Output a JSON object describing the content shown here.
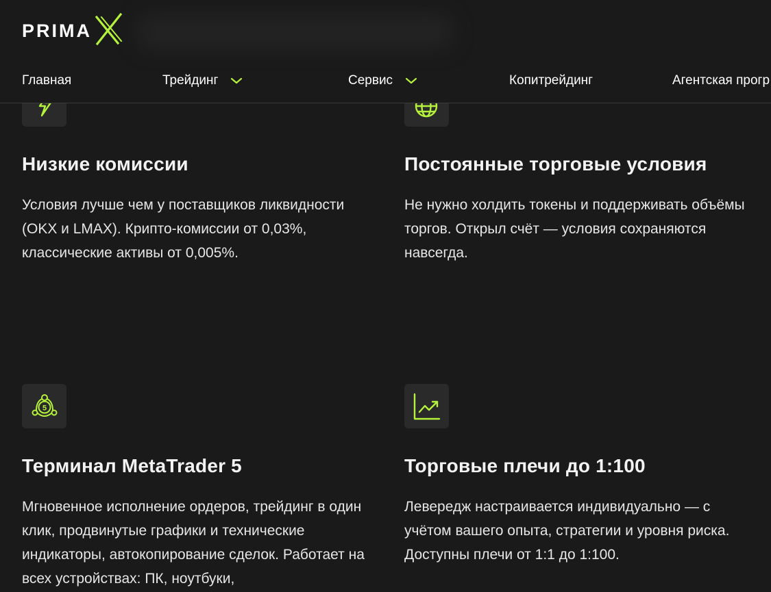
{
  "brand": {
    "name": "PRIMA",
    "mark": "X",
    "accent": "#b5f23c"
  },
  "nav": {
    "items": [
      {
        "label": "Главная",
        "has_dropdown": false
      },
      {
        "label": "Трейдинг",
        "has_dropdown": true
      },
      {
        "label": "Сервис",
        "has_dropdown": true
      },
      {
        "label": "Копитрейдинг",
        "has_dropdown": false
      },
      {
        "label": "Агентская прогр",
        "has_dropdown": false
      }
    ]
  },
  "features": [
    {
      "icon": "lightning-icon",
      "title": "Низкие комиссии",
      "text": "Условия лучше чем у поставщиков ликвидности (OKX и LMAX). Крипто-комиссии от 0,03%, классические активы от 0,005%."
    },
    {
      "icon": "globe-icon",
      "title": "Постоянные торговые условия",
      "text": "Не нужно холдить токены и поддерживать объёмы торгов. Открыл счёт — условия сохраняются навсегда."
    },
    {
      "icon": "metatrader-icon",
      "icon_label": "5",
      "title": "Терминал MetaTrader 5",
      "text": "Мгновенное исполнение ордеров, трейдинг в один клик, продвинутые графики и технические индикаторы, автокопирование сделок. Работает на всех устройствах: ПК, ноутбуки,"
    },
    {
      "icon": "trending-chart-icon",
      "title": "Торговые плечи до 1:100",
      "text": "Левередж настраивается индивидуально — с учётом вашего опыта, стратегии и уровня риска. Доступны плечи от 1:1 до 1:100."
    }
  ]
}
